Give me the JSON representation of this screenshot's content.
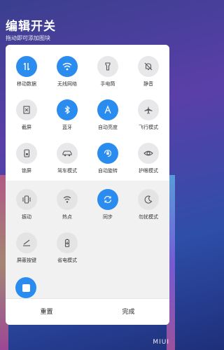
{
  "header": {
    "title": "编辑开关",
    "subtitle": "拖动即可添加图块"
  },
  "tiles": [
    {
      "label": "移动数据",
      "icon": "data-transfer-icon",
      "state": "on"
    },
    {
      "label": "无线网络",
      "icon": "wifi-icon",
      "state": "on"
    },
    {
      "label": "手电筒",
      "icon": "flashlight-icon",
      "state": "off"
    },
    {
      "label": "静音",
      "icon": "bell-mute-icon",
      "state": "off"
    },
    {
      "label": "截屏",
      "icon": "screenshot-icon",
      "state": "off"
    },
    {
      "label": "蓝牙",
      "icon": "bluetooth-icon",
      "state": "on"
    },
    {
      "label": "自动亮度",
      "icon": "auto-brightness-icon",
      "state": "on"
    },
    {
      "label": "飞行模式",
      "icon": "airplane-icon",
      "state": "off"
    },
    {
      "label": "锁屏",
      "icon": "lock-screen-icon",
      "state": "off"
    },
    {
      "label": "驾车模式",
      "icon": "car-icon",
      "state": "off"
    },
    {
      "label": "自动旋转",
      "icon": "rotate-lock-icon",
      "state": "on"
    },
    {
      "label": "护眼模式",
      "icon": "eye-icon",
      "state": "off"
    },
    {
      "label": "振动",
      "icon": "vibrate-icon",
      "state": "off"
    },
    {
      "label": "热点",
      "icon": "hotspot-icon",
      "state": "off"
    },
    {
      "label": "同步",
      "icon": "sync-icon",
      "state": "on"
    },
    {
      "label": "勿扰模式",
      "icon": "moon-icon",
      "state": "off"
    },
    {
      "label": "屏蔽按键",
      "icon": "block-keys-icon",
      "state": "off"
    },
    {
      "label": "省电模式",
      "icon": "battery-saver-icon",
      "state": "off"
    }
  ],
  "footer": {
    "reset_label": "重置",
    "done_label": "完成"
  },
  "brand": "MIUI",
  "colors": {
    "accent": "#2b8cf0",
    "off": "#e8e8ea"
  }
}
